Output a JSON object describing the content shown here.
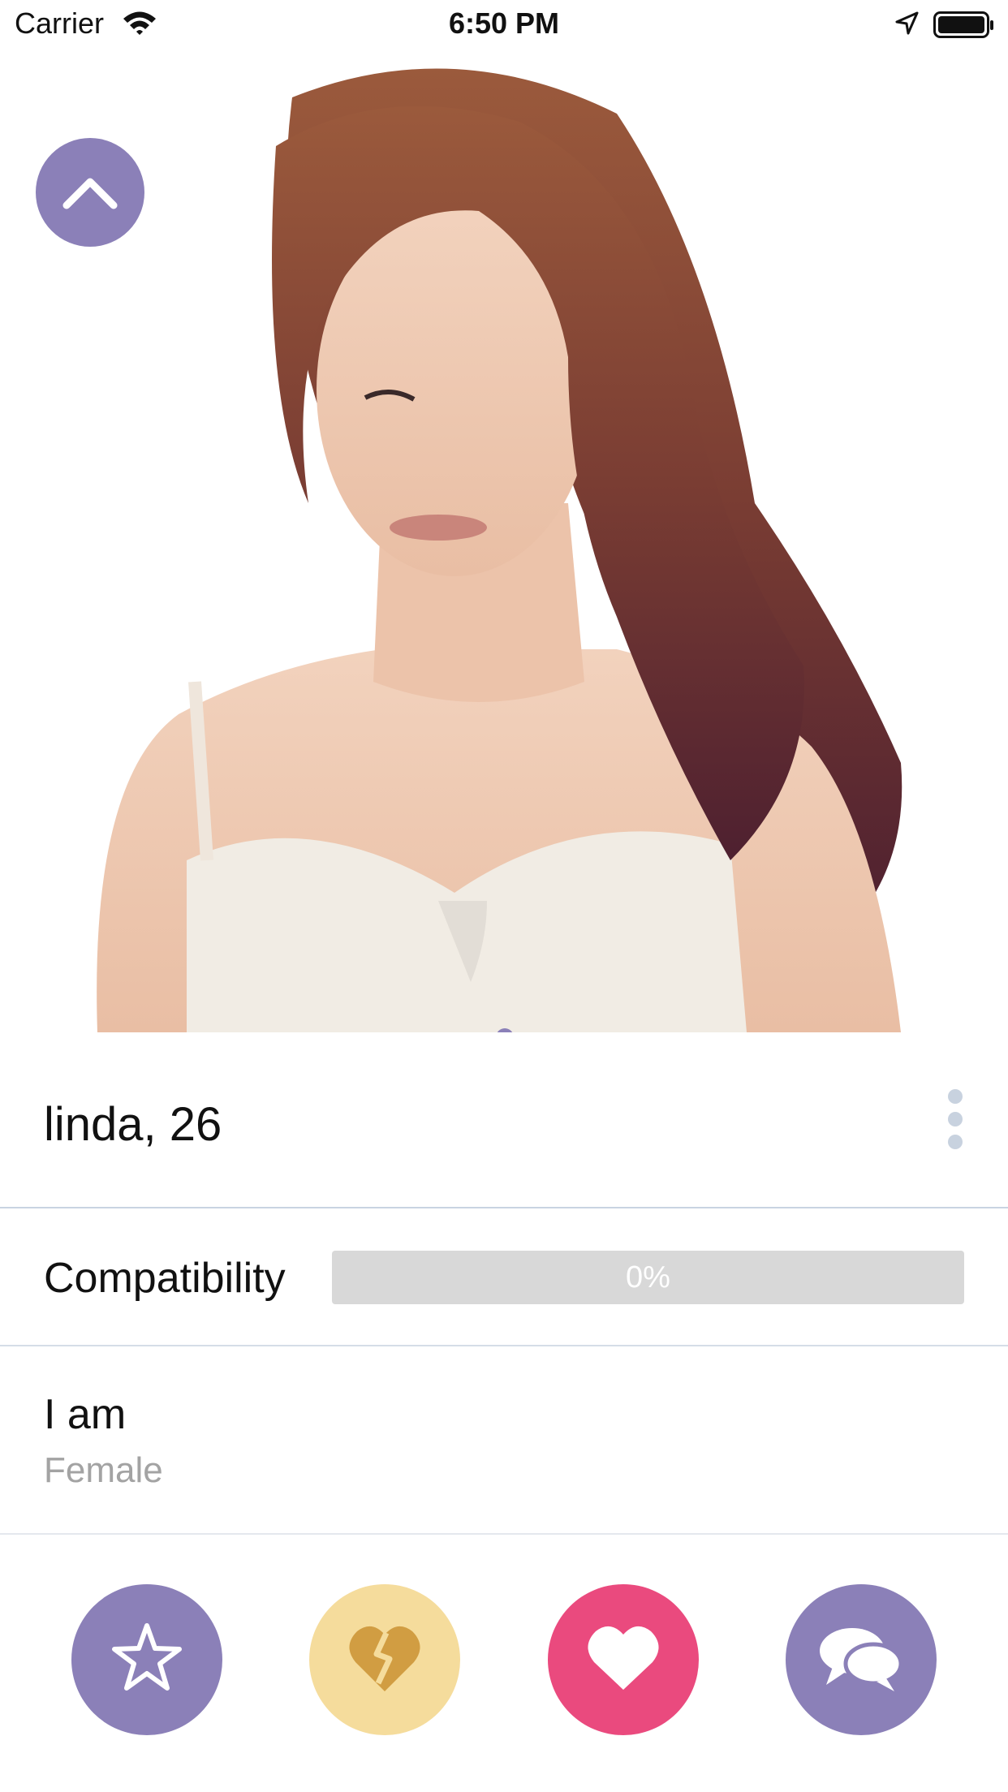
{
  "status_bar": {
    "carrier": "Carrier",
    "time": "6:50 PM",
    "icons": [
      "wifi-icon",
      "location-arrow-icon",
      "battery-icon"
    ]
  },
  "profile": {
    "photo": {
      "subject": "profile-photo",
      "pages": 1,
      "current_page": 1
    },
    "name_age": "linda, 26",
    "compatibility": {
      "label": "Compatibility",
      "value_text": "0%",
      "value": 0
    },
    "gender": {
      "label": "I am",
      "value": "Female"
    }
  },
  "header": {
    "collapse_icon": "chevron-up-icon"
  },
  "actions": [
    {
      "name": "favorite",
      "icon": "star-icon",
      "color": "#8b80b8"
    },
    {
      "name": "dislike",
      "icon": "broken-heart-icon",
      "color": "#f5dc9c"
    },
    {
      "name": "like",
      "icon": "heart-icon",
      "color": "#ea4a7e"
    },
    {
      "name": "chat",
      "icon": "chat-bubbles-icon",
      "color": "#8b80b8"
    }
  ],
  "colors": {
    "accent": "#8b80b8",
    "divider": "#c9d4e2",
    "muted_text": "#a3a3a3"
  }
}
